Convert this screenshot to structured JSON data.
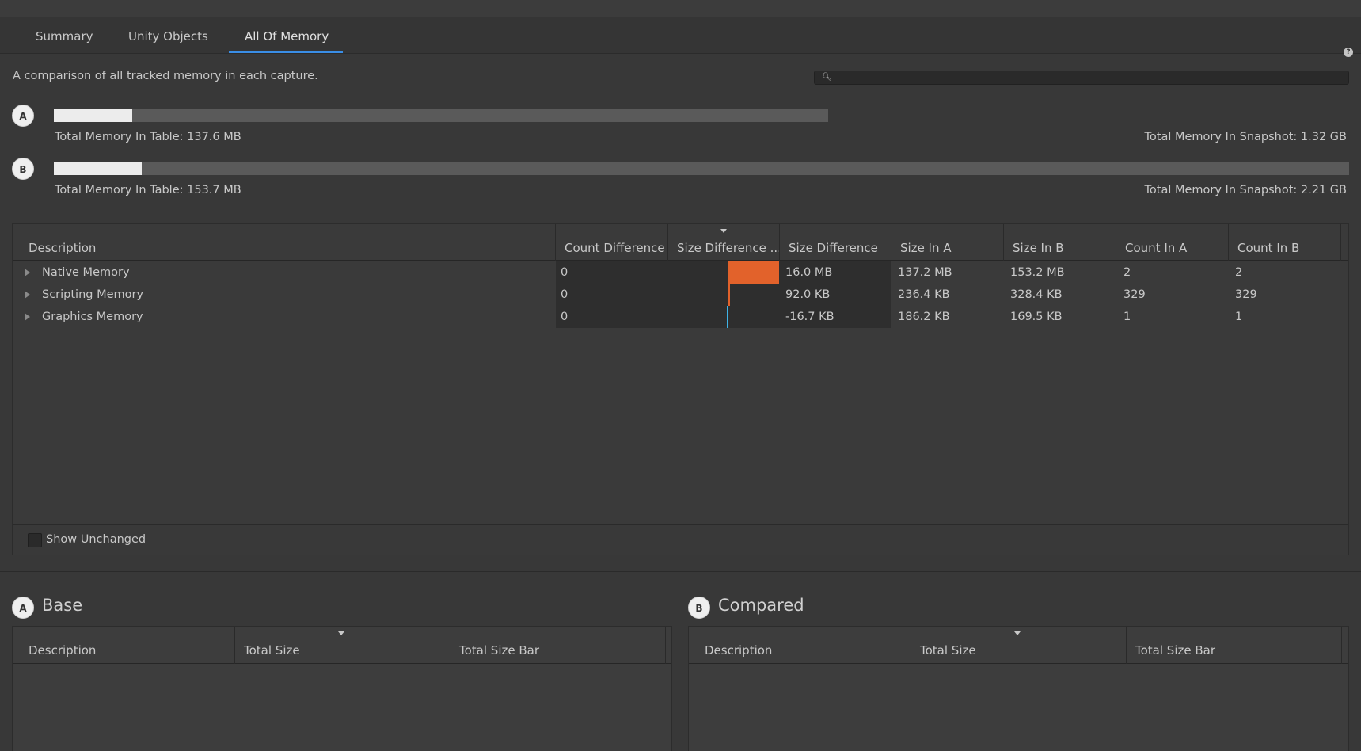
{
  "tabs": [
    {
      "label": "Summary"
    },
    {
      "label": "Unity Objects"
    },
    {
      "label": "All Of Memory"
    }
  ],
  "active_tab": "All Of Memory",
  "help_icon": "?",
  "description": "A comparison of all tracked memory in each capture.",
  "search": {
    "value": "",
    "icon": "search-icon"
  },
  "capture_a": {
    "badge": "A",
    "table_total": "Total Memory In Table: 137.6 MB",
    "snapshot_total": "Total Memory In Snapshot: 1.32 GB",
    "fill_fraction": 0.101,
    "bar_scale_fraction": 0.597
  },
  "capture_b": {
    "badge": "B",
    "table_total": "Total Memory In Table: 153.7 MB",
    "snapshot_total": "Total Memory In Snapshot: 2.21 GB",
    "fill_fraction": 0.068,
    "bar_scale_fraction": 1.0
  },
  "main_table": {
    "columns": [
      "Description",
      "Count Difference",
      "Size Difference ...",
      "Size Difference",
      "Size In A",
      "Size In B",
      "Count In A",
      "Count In B"
    ],
    "rows": [
      {
        "description": "Native Memory",
        "count_diff": "0",
        "size_diff_bar_fraction": 1.0,
        "size_diff": "16.0 MB",
        "size_a": "137.2 MB",
        "size_b": "153.2 MB",
        "count_a": "2",
        "count_b": "2"
      },
      {
        "description": "Scripting Memory",
        "count_diff": "0",
        "size_diff_bar_fraction": 0.006,
        "size_diff": "92.0 KB",
        "size_a": "236.4 KB",
        "size_b": "328.4 KB",
        "count_a": "329",
        "count_b": "329"
      },
      {
        "description": "Graphics Memory",
        "count_diff": "0",
        "size_diff_bar_fraction": -0.001,
        "size_diff": "-16.7 KB",
        "size_a": "186.2 KB",
        "size_b": "169.5 KB",
        "count_a": "1",
        "count_b": "1"
      }
    ],
    "show_unchanged": {
      "label": "Show Unchanged",
      "checked": false
    }
  },
  "base": {
    "badge": "A",
    "title": "Base",
    "columns": [
      "Description",
      "Total Size",
      "Total Size Bar"
    ]
  },
  "compared": {
    "badge": "B",
    "title": "Compared",
    "columns": [
      "Description",
      "Total Size",
      "Total Size Bar"
    ]
  },
  "colors": {
    "positive_bar": "#e2622b",
    "negative_bar": "#3fb3e6",
    "tab_underline": "#3a8ee6"
  }
}
